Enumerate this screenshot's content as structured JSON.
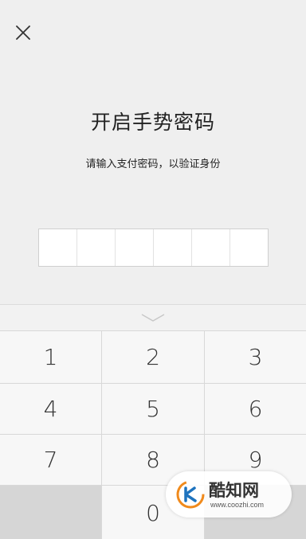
{
  "header": {
    "close_icon": "close-icon",
    "title": "开启手势密码",
    "subtitle": "请输入支付密码，以验证身份"
  },
  "pin": {
    "length": 6,
    "filled": 0
  },
  "keyboard": {
    "collapse_icon": "chevron-down-icon",
    "keys": [
      "1",
      "2",
      "3",
      "4",
      "5",
      "6",
      "7",
      "8",
      "9",
      "",
      "0",
      ""
    ]
  },
  "watermark": {
    "brand": "酷知网",
    "url": "www.coozhi.com",
    "colors": {
      "orange": "#f08a1c",
      "blue": "#1e73be"
    }
  }
}
